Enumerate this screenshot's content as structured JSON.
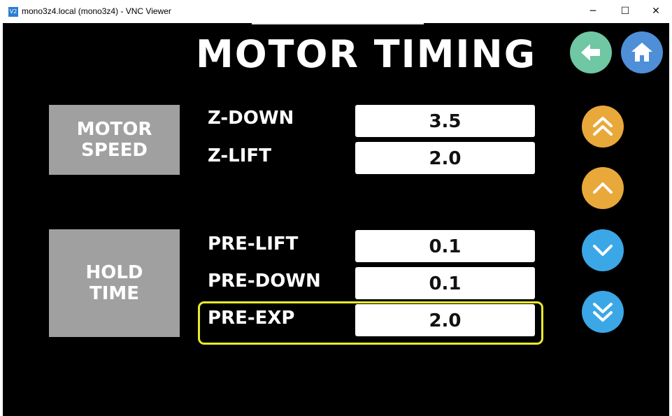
{
  "window": {
    "title": "mono3z4.local (mono3z4) - VNC Viewer",
    "app_icon_glyph": "V2",
    "minimize_glyph": "─",
    "maximize_glyph": "☐",
    "close_glyph": "✕"
  },
  "screen": {
    "title": "MOTOR TIMING",
    "nav": {
      "back_icon": "arrow-left-icon",
      "home_icon": "home-icon"
    },
    "sections": [
      {
        "title": "MOTOR\nSPEED",
        "title_line1": "MOTOR",
        "title_line2": "SPEED"
      },
      {
        "title": "HOLD\nTIME",
        "title_line1": "HOLD",
        "title_line2": "TIME"
      }
    ],
    "rows": [
      {
        "label": "Z-DOWN",
        "value": "3.5"
      },
      {
        "label": "Z-LIFT",
        "value": "2.0"
      },
      {
        "label": "PRE-LIFT",
        "value": "0.1"
      },
      {
        "label": "PRE-DOWN",
        "value": "0.1"
      },
      {
        "label": "PRE-EXP",
        "value": "2.0",
        "selected": true
      }
    ],
    "steppers": [
      {
        "name": "increase-large",
        "icon": "double-chevron-up-icon",
        "color": "#e8a83a"
      },
      {
        "name": "increase-small",
        "icon": "chevron-up-icon",
        "color": "#e8a83a"
      },
      {
        "name": "decrease-small",
        "icon": "chevron-down-icon",
        "color": "#3ba7e6"
      },
      {
        "name": "decrease-large",
        "icon": "double-chevron-down-icon",
        "color": "#3ba7e6"
      }
    ]
  },
  "colors": {
    "background": "#000000",
    "section_box": "#a0a0a0",
    "selection_outline": "#eaea2a",
    "back_button": "#6fc7a3",
    "home_button": "#4f8fd8"
  }
}
